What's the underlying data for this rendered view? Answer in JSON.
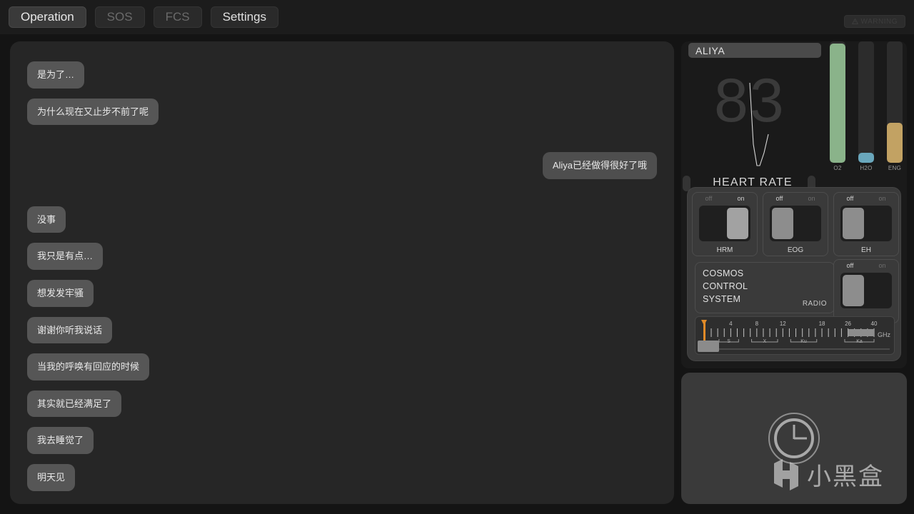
{
  "tabs": [
    {
      "label": "Operation",
      "state": "active"
    },
    {
      "label": "SOS",
      "state": "dim"
    },
    {
      "label": "FCS",
      "state": "dim"
    },
    {
      "label": "Settings",
      "state": "normal"
    }
  ],
  "warning_button": {
    "label": "WARNING",
    "icon": "warning-triangle-icon"
  },
  "chat": {
    "messages": [
      {
        "side": "left",
        "text": "是为了…",
        "gap_after": false
      },
      {
        "side": "left",
        "text": "为什么现在又止步不前了呢",
        "gap_after": true
      },
      {
        "side": "right",
        "text": "Aliya已经做得很好了哦",
        "gap_after": true
      },
      {
        "side": "left",
        "text": "没事",
        "gap_after": false
      },
      {
        "side": "left",
        "text": "我只是有点…",
        "gap_after": false
      },
      {
        "side": "left",
        "text": "想发发牢骚",
        "gap_after": false
      },
      {
        "side": "left",
        "text": "谢谢你听我说话",
        "gap_after": false
      },
      {
        "side": "left",
        "text": "当我的呼唤有回应的时候",
        "gap_after": false
      },
      {
        "side": "left",
        "text": "其实就已经满足了",
        "gap_after": false
      },
      {
        "side": "left",
        "text": "我去睡觉了",
        "gap_after": false
      },
      {
        "side": "left",
        "text": "明天见",
        "gap_after": false
      }
    ]
  },
  "vitals": {
    "name": "ALIYA",
    "heart_rate": "83",
    "heart_rate_label": "HEART RATE",
    "gauges": [
      {
        "id": "o2",
        "label": "O2",
        "percent": 98,
        "color": "#8ab38a"
      },
      {
        "id": "h2o",
        "label": "H2O",
        "percent": 8,
        "color": "#6aa7bc"
      },
      {
        "id": "eng",
        "label": "ENG",
        "percent": 33,
        "color": "#c2a263"
      }
    ]
  },
  "switches": [
    {
      "name": "HRM",
      "state": "on",
      "off_label": "off",
      "on_label": "on"
    },
    {
      "name": "EOG",
      "state": "off",
      "off_label": "off",
      "on_label": "on"
    },
    {
      "name": "EH",
      "state": "off",
      "off_label": "off",
      "on_label": "on"
    },
    {
      "name": "RADIO",
      "state": "off",
      "off_label": "off",
      "on_label": "on"
    }
  ],
  "cosmos": {
    "line1": "COSMOS",
    "line2": "CONTROL",
    "line3": "SYSTEM",
    "radio_label": "RADIO"
  },
  "tuner": {
    "unit": "GHz",
    "tick_labels": [
      "4",
      "8",
      "12",
      "18",
      "26",
      "40"
    ],
    "band_labels": [
      "S",
      "X",
      "Ku",
      "Ka"
    ],
    "handle_position_percent": 2,
    "highlighted_band": "Ka"
  },
  "clock": {
    "icon": "clock-icon",
    "hands": "3 o'clock"
  },
  "watermark": {
    "text": "小黑盒",
    "logo": "xiaoheihe-logo-icon"
  },
  "colors": {
    "page_bg": "#141414",
    "panel_bg": "#262626",
    "bubble_bg": "#565656",
    "accent_orange": "#e08a28",
    "o2_green": "#8ab38a",
    "h2o_blue": "#6aa7bc",
    "eng_tan": "#c2a263"
  }
}
